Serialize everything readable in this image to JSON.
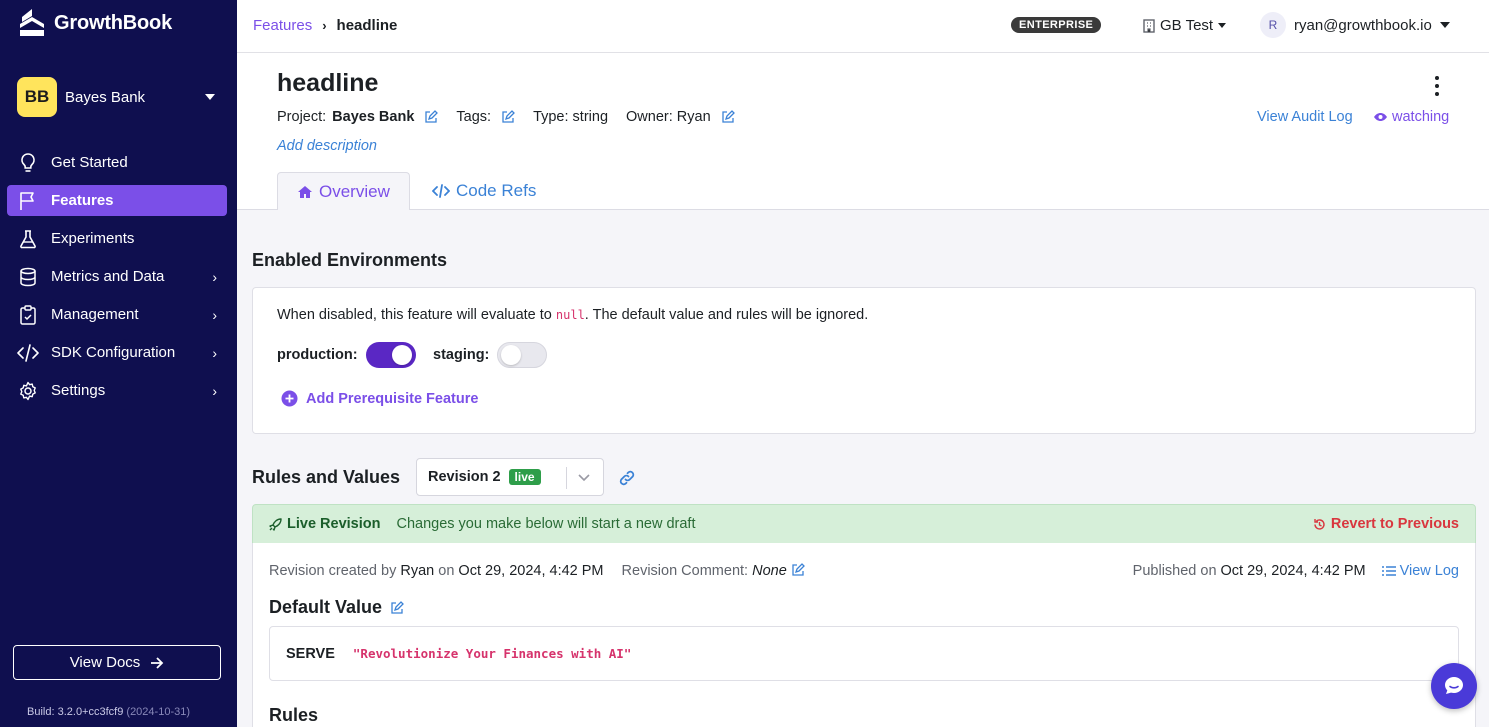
{
  "app": {
    "name": "GrowthBook"
  },
  "sidebar": {
    "org_initials": "BB",
    "org_name": "Bayes Bank",
    "items": [
      {
        "label": "Get Started",
        "icon": "lightbulb-icon"
      },
      {
        "label": "Features",
        "icon": "flag-icon",
        "active": true
      },
      {
        "label": "Experiments",
        "icon": "flask-icon"
      },
      {
        "label": "Metrics and Data",
        "icon": "database-icon",
        "expandable": true
      },
      {
        "label": "Management",
        "icon": "clipboard-icon",
        "expandable": true
      },
      {
        "label": "SDK Configuration",
        "icon": "code-icon",
        "expandable": true
      },
      {
        "label": "Settings",
        "icon": "gear-icon",
        "expandable": true
      }
    ],
    "view_docs": "View Docs",
    "build_label": "Build:",
    "build_version": "3.2.0+cc3fcf9",
    "build_date": "(2024-10-31)"
  },
  "topbar": {
    "breadcrumb_parent": "Features",
    "breadcrumb_current": "headline",
    "plan_badge": "ENTERPRISE",
    "org_switch": "GB Test",
    "user_initial": "R",
    "user_email": "ryan@growthbook.io"
  },
  "feature": {
    "title": "headline",
    "project_label": "Project:",
    "project_value": "Bayes Bank",
    "tags_label": "Tags:",
    "type_label": "Type: string",
    "owner_label": "Owner: Ryan",
    "audit_log": "View Audit Log",
    "watching": "watching",
    "add_description": "Add description",
    "tabs": {
      "overview": "Overview",
      "code_refs": "Code Refs"
    }
  },
  "environments": {
    "title": "Enabled Environments",
    "note_before": "When disabled, this feature will evaluate to ",
    "note_code": "null",
    "note_after": ". The default value and rules will be ignored.",
    "production_label": "production:",
    "production_on": true,
    "staging_label": "staging:",
    "staging_on": false,
    "add_prereq": "Add Prerequisite Feature"
  },
  "rules": {
    "title": "Rules and Values",
    "revision": "Revision 2",
    "revision_badge": "live",
    "banner_title": "Live Revision",
    "banner_msg": "Changes you make below will start a new draft",
    "revert": "Revert to Previous",
    "created_prefix": "Revision created by ",
    "created_by": "Ryan",
    "created_on": " on ",
    "created_date": "Oct 29, 2024, 4:42 PM",
    "comment_label": "Revision Comment: ",
    "comment_value": "None",
    "published_label": "Published on ",
    "published_date": "Oct 29, 2024, 4:42 PM",
    "view_log": "View Log",
    "default_value_title": "Default Value",
    "serve_label": "SERVE",
    "serve_value": "\"Revolutionize Your Finances with AI\"",
    "rules_title": "Rules"
  },
  "colors": {
    "sidebar_bg": "#0f0f4f",
    "accent": "#7b4fe8",
    "link": "#3b82d6",
    "live": "#2e9e4a",
    "danger": "#d9363e"
  }
}
